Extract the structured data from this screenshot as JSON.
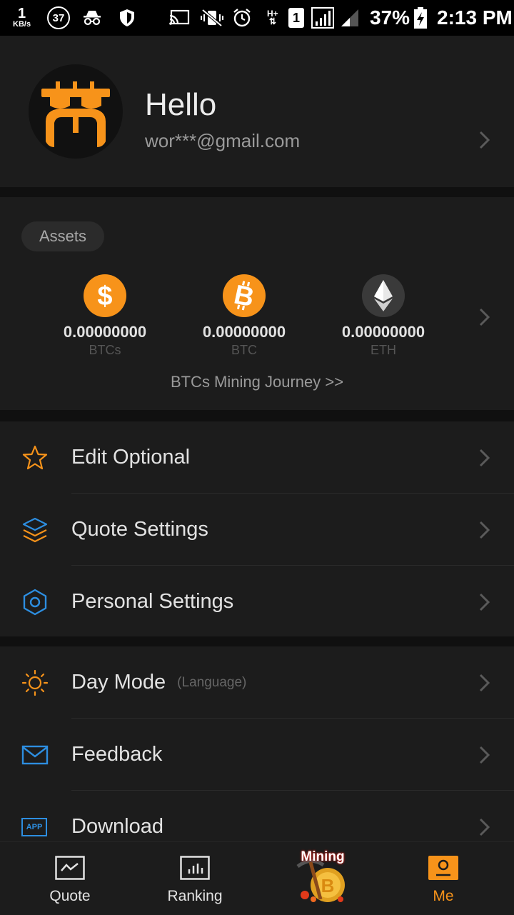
{
  "status_bar": {
    "net_speed_value": "1",
    "net_speed_unit": "KB/s",
    "notif_count": "37",
    "battery": "37%",
    "time": "2:13 PM",
    "sim_badge": "1",
    "network_type": "H+"
  },
  "profile": {
    "greeting": "Hello",
    "email": "wor***@gmail.com"
  },
  "assets": {
    "title": "Assets",
    "coins": [
      {
        "amount": "0.00000000",
        "symbol": "BTCs",
        "icon": "dollar-coin-icon",
        "color": "#f7931a"
      },
      {
        "amount": "0.00000000",
        "symbol": "BTC",
        "icon": "bitcoin-icon",
        "color": "#f7931a"
      },
      {
        "amount": "0.00000000",
        "symbol": "ETH",
        "icon": "ethereum-icon",
        "color": "#3a3a3a"
      }
    ],
    "journey_link": "BTCs Mining Journey >>"
  },
  "menu_group1": [
    {
      "label": "Edit Optional",
      "icon": "star-icon"
    },
    {
      "label": "Quote Settings",
      "icon": "layers-icon"
    },
    {
      "label": "Personal Settings",
      "icon": "hexagon-icon"
    }
  ],
  "menu_group2": [
    {
      "label": "Day Mode",
      "sublabel": "(Language)",
      "icon": "sun-icon"
    },
    {
      "label": "Feedback",
      "icon": "mail-icon"
    },
    {
      "label": "Download",
      "icon": "app-icon",
      "icon_text": "APP"
    }
  ],
  "bottom_nav": [
    {
      "label": "Quote",
      "icon": "chart-icon",
      "active": false
    },
    {
      "label": "Ranking",
      "icon": "bar-chart-icon",
      "active": false
    },
    {
      "label": "",
      "icon": "mining-icon",
      "badge_text": "Mining",
      "active": false
    },
    {
      "label": "Me",
      "icon": "profile-icon",
      "active": true
    }
  ],
  "colors": {
    "accent": "#f7931a",
    "blue": "#2d8ee0",
    "background": "#1c1c1c"
  }
}
